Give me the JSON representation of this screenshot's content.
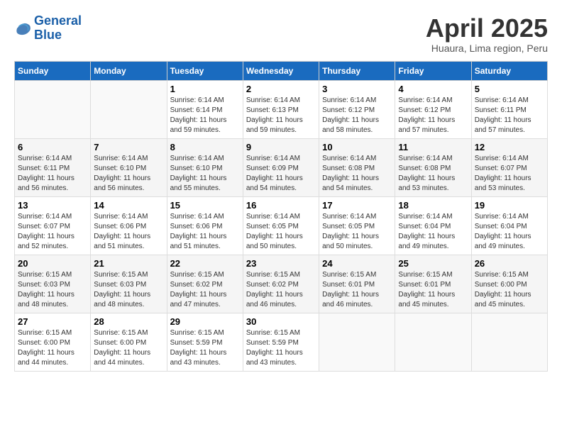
{
  "header": {
    "logo_line1": "General",
    "logo_line2": "Blue",
    "month_title": "April 2025",
    "subtitle": "Huaura, Lima region, Peru"
  },
  "calendar": {
    "days_of_week": [
      "Sunday",
      "Monday",
      "Tuesday",
      "Wednesday",
      "Thursday",
      "Friday",
      "Saturday"
    ],
    "weeks": [
      [
        {
          "day": "",
          "info": ""
        },
        {
          "day": "",
          "info": ""
        },
        {
          "day": "1",
          "info": "Sunrise: 6:14 AM\nSunset: 6:14 PM\nDaylight: 11 hours\nand 59 minutes."
        },
        {
          "day": "2",
          "info": "Sunrise: 6:14 AM\nSunset: 6:13 PM\nDaylight: 11 hours\nand 59 minutes."
        },
        {
          "day": "3",
          "info": "Sunrise: 6:14 AM\nSunset: 6:12 PM\nDaylight: 11 hours\nand 58 minutes."
        },
        {
          "day": "4",
          "info": "Sunrise: 6:14 AM\nSunset: 6:12 PM\nDaylight: 11 hours\nand 57 minutes."
        },
        {
          "day": "5",
          "info": "Sunrise: 6:14 AM\nSunset: 6:11 PM\nDaylight: 11 hours\nand 57 minutes."
        }
      ],
      [
        {
          "day": "6",
          "info": "Sunrise: 6:14 AM\nSunset: 6:11 PM\nDaylight: 11 hours\nand 56 minutes."
        },
        {
          "day": "7",
          "info": "Sunrise: 6:14 AM\nSunset: 6:10 PM\nDaylight: 11 hours\nand 56 minutes."
        },
        {
          "day": "8",
          "info": "Sunrise: 6:14 AM\nSunset: 6:10 PM\nDaylight: 11 hours\nand 55 minutes."
        },
        {
          "day": "9",
          "info": "Sunrise: 6:14 AM\nSunset: 6:09 PM\nDaylight: 11 hours\nand 54 minutes."
        },
        {
          "day": "10",
          "info": "Sunrise: 6:14 AM\nSunset: 6:08 PM\nDaylight: 11 hours\nand 54 minutes."
        },
        {
          "day": "11",
          "info": "Sunrise: 6:14 AM\nSunset: 6:08 PM\nDaylight: 11 hours\nand 53 minutes."
        },
        {
          "day": "12",
          "info": "Sunrise: 6:14 AM\nSunset: 6:07 PM\nDaylight: 11 hours\nand 53 minutes."
        }
      ],
      [
        {
          "day": "13",
          "info": "Sunrise: 6:14 AM\nSunset: 6:07 PM\nDaylight: 11 hours\nand 52 minutes."
        },
        {
          "day": "14",
          "info": "Sunrise: 6:14 AM\nSunset: 6:06 PM\nDaylight: 11 hours\nand 51 minutes."
        },
        {
          "day": "15",
          "info": "Sunrise: 6:14 AM\nSunset: 6:06 PM\nDaylight: 11 hours\nand 51 minutes."
        },
        {
          "day": "16",
          "info": "Sunrise: 6:14 AM\nSunset: 6:05 PM\nDaylight: 11 hours\nand 50 minutes."
        },
        {
          "day": "17",
          "info": "Sunrise: 6:14 AM\nSunset: 6:05 PM\nDaylight: 11 hours\nand 50 minutes."
        },
        {
          "day": "18",
          "info": "Sunrise: 6:14 AM\nSunset: 6:04 PM\nDaylight: 11 hours\nand 49 minutes."
        },
        {
          "day": "19",
          "info": "Sunrise: 6:14 AM\nSunset: 6:04 PM\nDaylight: 11 hours\nand 49 minutes."
        }
      ],
      [
        {
          "day": "20",
          "info": "Sunrise: 6:15 AM\nSunset: 6:03 PM\nDaylight: 11 hours\nand 48 minutes."
        },
        {
          "day": "21",
          "info": "Sunrise: 6:15 AM\nSunset: 6:03 PM\nDaylight: 11 hours\nand 48 minutes."
        },
        {
          "day": "22",
          "info": "Sunrise: 6:15 AM\nSunset: 6:02 PM\nDaylight: 11 hours\nand 47 minutes."
        },
        {
          "day": "23",
          "info": "Sunrise: 6:15 AM\nSunset: 6:02 PM\nDaylight: 11 hours\nand 46 minutes."
        },
        {
          "day": "24",
          "info": "Sunrise: 6:15 AM\nSunset: 6:01 PM\nDaylight: 11 hours\nand 46 minutes."
        },
        {
          "day": "25",
          "info": "Sunrise: 6:15 AM\nSunset: 6:01 PM\nDaylight: 11 hours\nand 45 minutes."
        },
        {
          "day": "26",
          "info": "Sunrise: 6:15 AM\nSunset: 6:00 PM\nDaylight: 11 hours\nand 45 minutes."
        }
      ],
      [
        {
          "day": "27",
          "info": "Sunrise: 6:15 AM\nSunset: 6:00 PM\nDaylight: 11 hours\nand 44 minutes."
        },
        {
          "day": "28",
          "info": "Sunrise: 6:15 AM\nSunset: 6:00 PM\nDaylight: 11 hours\nand 44 minutes."
        },
        {
          "day": "29",
          "info": "Sunrise: 6:15 AM\nSunset: 5:59 PM\nDaylight: 11 hours\nand 43 minutes."
        },
        {
          "day": "30",
          "info": "Sunrise: 6:15 AM\nSunset: 5:59 PM\nDaylight: 11 hours\nand 43 minutes."
        },
        {
          "day": "",
          "info": ""
        },
        {
          "day": "",
          "info": ""
        },
        {
          "day": "",
          "info": ""
        }
      ]
    ]
  }
}
